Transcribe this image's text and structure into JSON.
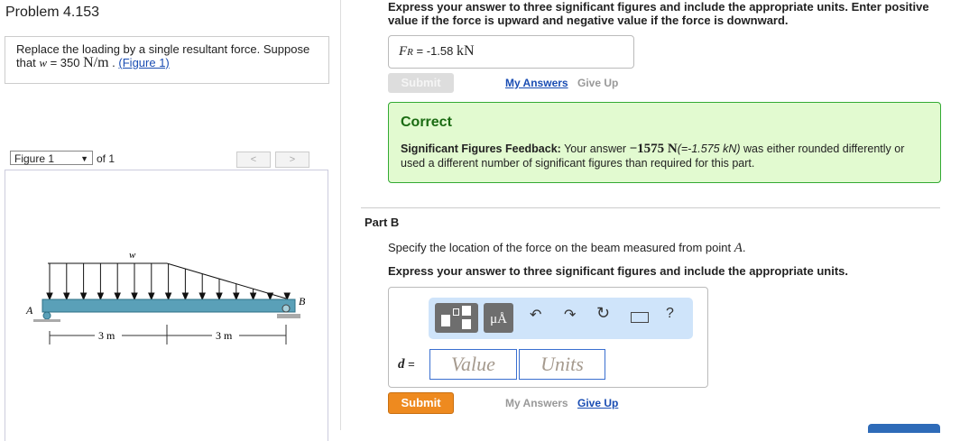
{
  "left": {
    "title": "Problem 4.153",
    "problem_text": "Replace the loading by a single resultant force. Suppose that",
    "var": "w",
    "eq": " = 350 ",
    "unit": "N/m",
    "figure_link": "(Figure 1)",
    "figure_select": "Figure 1",
    "figure_of": "of 1",
    "prev": "<",
    "next": ">",
    "diagram": {
      "w": "w",
      "a": "A",
      "b": "B",
      "d1": "3 m",
      "d2": "3 m"
    }
  },
  "partA": {
    "instructions": "Express your answer to three significant figures and include the appropriate units. Enter positive value if the force is upward and negative value if the force is downward.",
    "label": "F",
    "label_sub": "R",
    "eq": " = ",
    "value": "-1.58",
    "unit": "kN",
    "submit": "Submit",
    "my_answers": "My Answers",
    "give_up": "Give Up",
    "feedback_title": "Correct",
    "feedback_bold": "Significant Figures Feedback:",
    "feedback_pre": " Your answer ",
    "feedback_val": "−1575 N",
    "feedback_alt": "(=-1.575 kN)",
    "feedback_post": " was either rounded differently or used a different number of significant figures than required for this part."
  },
  "partB": {
    "title": "Part B",
    "question": "Specify the location of the force on the beam measured from point ",
    "point": "A",
    "instructions": "Express your answer to three significant figures and include the appropriate units.",
    "toolbar": {
      "units": "μÅ",
      "help": "?"
    },
    "label": "d",
    "eq": " =",
    "value_placeholder": "Value",
    "units_placeholder": "Units",
    "submit": "Submit",
    "my_answers": "My Answers",
    "give_up": "Give Up"
  }
}
